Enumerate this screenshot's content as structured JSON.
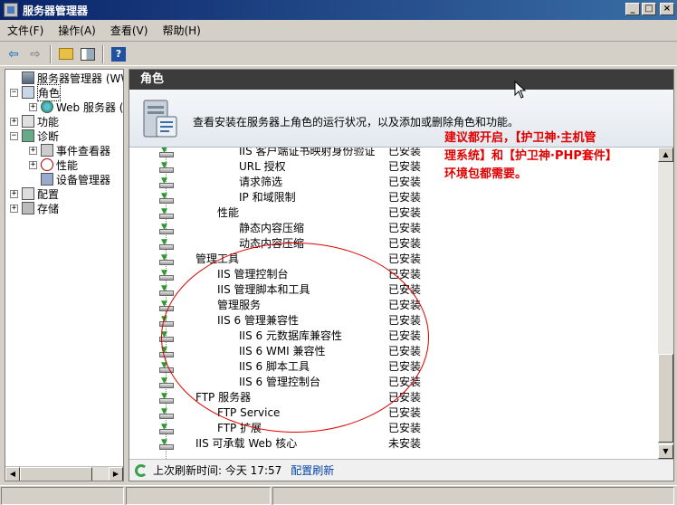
{
  "window": {
    "title": "服务器管理器"
  },
  "menu": [
    "文件(F)",
    "操作(A)",
    "查看(V)",
    "帮助(H)"
  ],
  "tree": {
    "items": [
      {
        "label": "服务器管理器 (WWS-",
        "icon": "server-icon",
        "level": 0,
        "expander": ""
      },
      {
        "label": "角色",
        "icon": "roles-icon",
        "level": 0,
        "expander": "−"
      },
      {
        "label": "Web 服务器 (IIS)",
        "icon": "web-server-icon",
        "level": 1,
        "expander": "+"
      },
      {
        "label": "功能",
        "icon": "features-icon",
        "level": 0,
        "expander": "+"
      },
      {
        "label": "诊断",
        "icon": "diagnostics-icon",
        "level": 0,
        "expander": "−"
      },
      {
        "label": "事件查看器",
        "icon": "event-viewer-icon",
        "level": 1,
        "expander": "+"
      },
      {
        "label": "性能",
        "icon": "performance-icon",
        "level": 1,
        "expander": "+"
      },
      {
        "label": "设备管理器",
        "icon": "device-manager-icon",
        "level": 1,
        "expander": ""
      },
      {
        "label": "配置",
        "icon": "configuration-icon",
        "level": 0,
        "expander": "+"
      },
      {
        "label": "存储",
        "icon": "storage-icon",
        "level": 0,
        "expander": "+"
      }
    ]
  },
  "main": {
    "header": "角色",
    "description": "查看安装在服务器上角色的运行状况，以及添加或删除角色和功能。",
    "rows": [
      {
        "name": "IIS 客户端证书映射身份验证",
        "indent": 3,
        "status": "已安装"
      },
      {
        "name": "URL 授权",
        "indent": 3,
        "status": "已安装"
      },
      {
        "name": "请求筛选",
        "indent": 3,
        "status": "已安装"
      },
      {
        "name": "IP 和域限制",
        "indent": 3,
        "status": "已安装"
      },
      {
        "name": "性能",
        "indent": 2,
        "status": "已安装"
      },
      {
        "name": "静态内容压缩",
        "indent": 3,
        "status": "已安装"
      },
      {
        "name": "动态内容压缩",
        "indent": 3,
        "status": "已安装"
      },
      {
        "name": "管理工具",
        "indent": 1,
        "status": "已安装"
      },
      {
        "name": "IIS 管理控制台",
        "indent": 2,
        "status": "已安装"
      },
      {
        "name": "IIS 管理脚本和工具",
        "indent": 2,
        "status": "已安装"
      },
      {
        "name": "管理服务",
        "indent": 2,
        "status": "已安装"
      },
      {
        "name": "IIS 6 管理兼容性",
        "indent": 2,
        "status": "已安装"
      },
      {
        "name": "IIS 6 元数据库兼容性",
        "indent": 3,
        "status": "已安装"
      },
      {
        "name": "IIS 6 WMI 兼容性",
        "indent": 3,
        "status": "已安装"
      },
      {
        "name": "IIS 6 脚本工具",
        "indent": 3,
        "status": "已安装"
      },
      {
        "name": "IIS 6 管理控制台",
        "indent": 3,
        "status": "已安装"
      },
      {
        "name": "FTP 服务器",
        "indent": 1,
        "status": "已安装"
      },
      {
        "name": "FTP Service",
        "indent": 2,
        "status": "已安装"
      },
      {
        "name": "FTP 扩展",
        "indent": 2,
        "status": "已安装"
      },
      {
        "name": "IIS 可承载 Web 核心",
        "indent": 1,
        "status": "未安装"
      }
    ],
    "note_lines": [
      "建议都开启，【护卫神·主机管",
      "理系统】和【护卫神·PHP套件】",
      "环境包都需要。"
    ],
    "footer": {
      "last_refresh_label": "上次刷新时间: 今天 17:57",
      "config_link": "配置刷新"
    }
  },
  "colors": {
    "header_bg": "#3c3c3c",
    "note": "#e00000",
    "link": "#0645ad"
  }
}
